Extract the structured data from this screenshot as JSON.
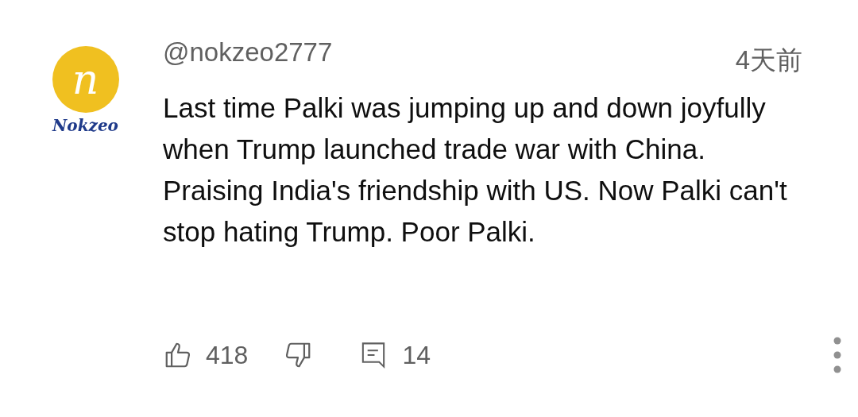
{
  "avatar": {
    "letter": "n",
    "caption": "Nokzeo"
  },
  "comment": {
    "author": "@nokzeo2777",
    "time": "4天前",
    "text": "Last time Palki was jumping up and down joyfully when Trump launched trade war with China. Praising India's friendship with US. Now Palki can't stop hating Trump. Poor Palki."
  },
  "actions": {
    "likes": "418",
    "replies": "14"
  }
}
